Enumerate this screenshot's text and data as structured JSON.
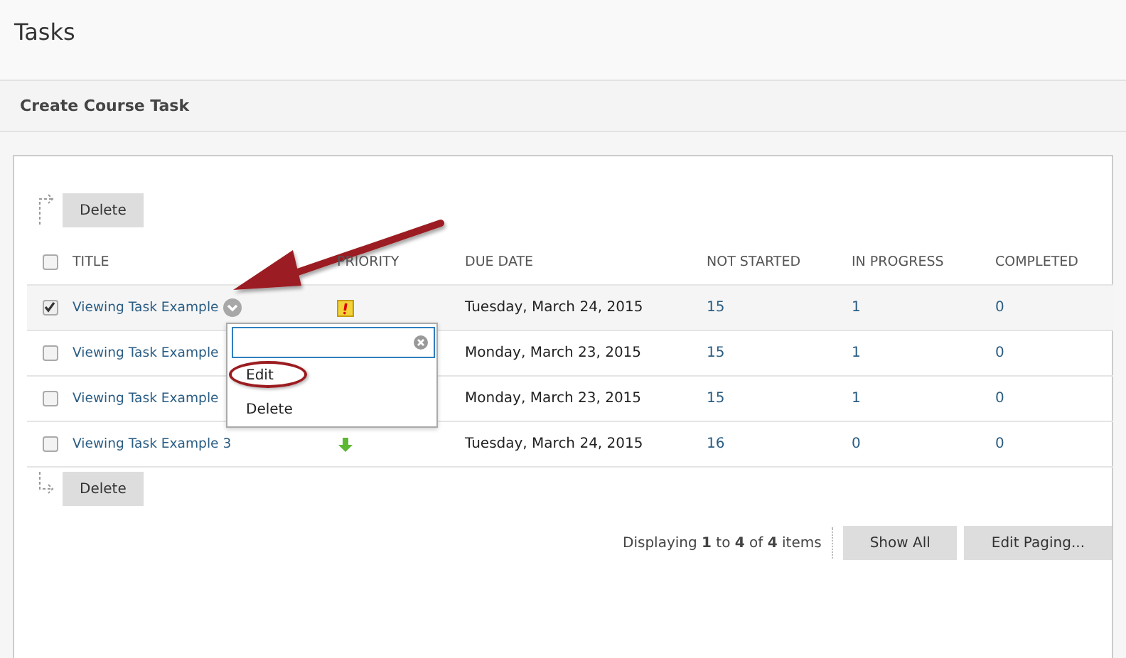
{
  "page_title": "Tasks",
  "action_bar": {
    "link": "Create Course Task"
  },
  "top_actions": [
    "Delete"
  ],
  "bottom_actions": [
    "Delete"
  ],
  "table": {
    "select_all": {
      "checked": false
    },
    "columns": [
      "TITLE",
      "PRIORITY",
      "DUE DATE",
      "NOT STARTED",
      "IN PROGRESS",
      "COMPLETED"
    ],
    "rows": [
      {
        "checked": true,
        "title": "Viewing Task Example",
        "menu_button": true,
        "priority": {
          "kind": "high"
        },
        "due": "Tuesday, March 24, 2015",
        "not_started": "15",
        "in_progress": "1",
        "completed": "0"
      },
      {
        "checked": false,
        "title": "Viewing Task Example",
        "due": "Monday, March 23, 2015",
        "not_started": "15",
        "in_progress": "1",
        "completed": "0"
      },
      {
        "checked": false,
        "title": "Viewing Task Example",
        "due": "Monday, March 23, 2015",
        "not_started": "15",
        "in_progress": "1",
        "completed": "0"
      },
      {
        "checked": false,
        "title": "Viewing Task Example 3",
        "priority": {
          "kind": "low"
        },
        "due": "Tuesday, March 24, 2015",
        "not_started": "16",
        "in_progress": "0",
        "completed": "0"
      }
    ]
  },
  "context_menu": {
    "items": [
      {
        "label": "Edit",
        "circled": true
      },
      {
        "label": "Delete",
        "circled": false
      }
    ]
  },
  "paging": {
    "summary": "Displaying **1** to **4** of **4** items",
    "buttons": [
      "Show All",
      "Edit Paging..."
    ]
  }
}
